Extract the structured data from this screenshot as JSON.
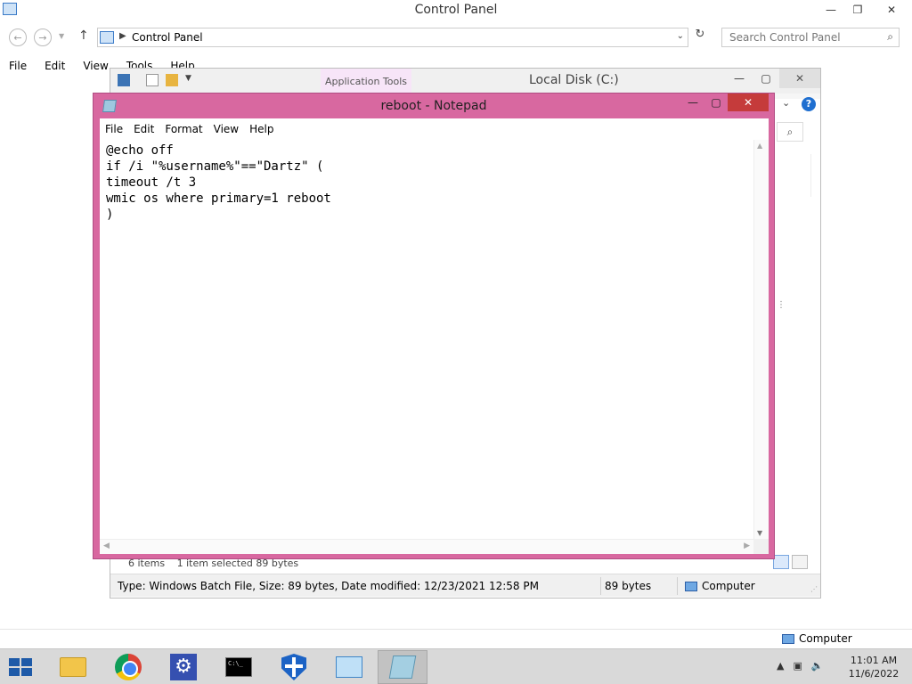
{
  "control_panel": {
    "title": "Control Panel",
    "address": "Control Panel",
    "search_placeholder": "Search Control Panel",
    "menu": [
      "File",
      "Edit",
      "View",
      "Tools",
      "Help"
    ],
    "status_location": "Computer"
  },
  "explorer": {
    "title": "Local Disk (C:)",
    "contextual_tab": "Application Tools",
    "items_count": "6 items",
    "selected": "1 item selected  89 bytes",
    "status_details": "Type: Windows Batch File, Size: 89 bytes, Date modified: 12/23/2021 12:58 PM",
    "status_size": "89 bytes",
    "status_location": "Computer"
  },
  "notepad": {
    "title": "reboot - Notepad",
    "menu": [
      "File",
      "Edit",
      "Format",
      "View",
      "Help"
    ],
    "content": "@echo off\nif /i \"%username%\"==\"Dartz\" (\ntimeout /t 3\nwmic os where primary=1 reboot\n)"
  },
  "taskbar": {
    "time": "11:01 AM",
    "date": "11/6/2022",
    "cmd_label": "C:\\_"
  },
  "colors": {
    "notepad_frame": "#d868a0",
    "close_button": "#c53b3b",
    "taskbar": "#d9d9d9"
  }
}
